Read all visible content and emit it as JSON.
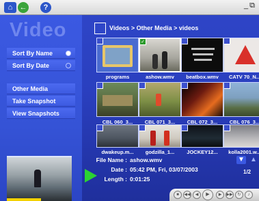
{
  "window": {
    "minimize": "_",
    "restore": "⧉"
  },
  "sidebar": {
    "title": "Video",
    "sort_items": [
      {
        "label": "Sort By Name",
        "selected": true
      },
      {
        "label": "Sort By Date",
        "selected": false
      }
    ],
    "actions": [
      "Other Media",
      "Take Snapshot",
      "View Snapshots"
    ]
  },
  "breadcrumb": "Videos > Other Media > videos",
  "grid": [
    {
      "label": "programs",
      "icon": "folder-icon"
    },
    {
      "label": "ashow.wmv",
      "icon": "video-thumbnail",
      "checked": true
    },
    {
      "label": "beatbox.wmv",
      "icon": "video-thumbnail"
    },
    {
      "label": "CATV 70_N...",
      "icon": "video-thumbnail"
    },
    {
      "label": "CBL 060_3...",
      "icon": "video-thumbnail"
    },
    {
      "label": "CBL 071_3...",
      "icon": "video-thumbnail"
    },
    {
      "label": "CBL 072_3...",
      "icon": "video-thumbnail"
    },
    {
      "label": "CBL 076_3...",
      "icon": "video-thumbnail"
    },
    {
      "label": "dwakeup.m...",
      "icon": "video-thumbnail"
    },
    {
      "label": "godzilla_1...",
      "icon": "video-thumbnail"
    },
    {
      "label": "JOCKEY12...",
      "icon": "video-thumbnail"
    },
    {
      "label": "kolla2001.w...",
      "icon": "video-thumbnail"
    }
  ],
  "details": {
    "file_name_label": "File Name :",
    "file_name": "ashow.wmv",
    "date_label": "Date :",
    "date": "05:42 PM, Fri, 03/07/2003",
    "length_label": "Length :",
    "length": "0:01:25"
  },
  "pager": {
    "current": "1/2"
  },
  "colors": {
    "background": "#2f46c8",
    "play_arrow": "#2bd332",
    "progress": "#f5d200"
  }
}
